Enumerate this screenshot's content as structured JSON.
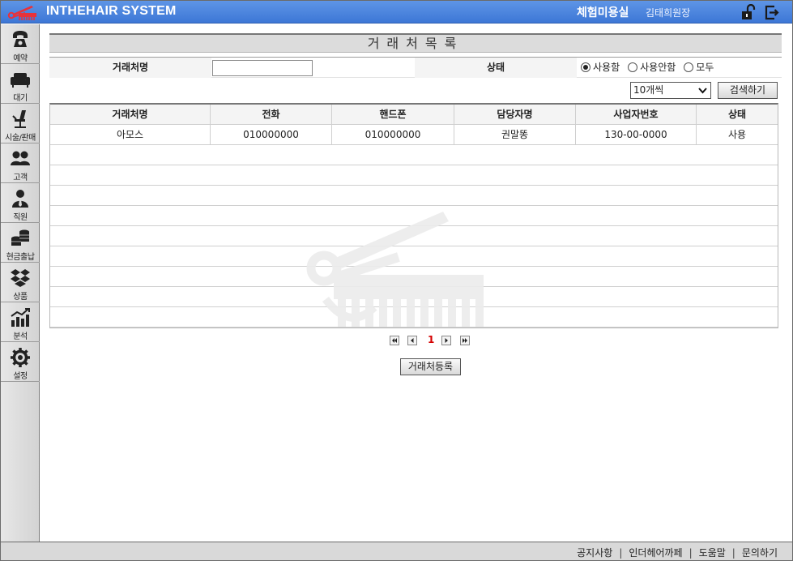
{
  "header": {
    "app_title": "INTHEHAIR SYSTEM",
    "shop_name": "체험미용실",
    "user_name": "김태희원장",
    "logo_icon": "scissors-comb-logo",
    "lock_icon": "unlock-icon",
    "logout_icon": "logout-icon",
    "colors": {
      "bar": "#4a85e0",
      "logo": "#e8323a"
    }
  },
  "sidebar": {
    "items": [
      {
        "label": "예약",
        "icon": "phone-icon"
      },
      {
        "label": "대기",
        "icon": "sofa-icon"
      },
      {
        "label": "시술/판매",
        "icon": "salon-chair-icon"
      },
      {
        "label": "고객",
        "icon": "customers-icon"
      },
      {
        "label": "직원",
        "icon": "staff-icon"
      },
      {
        "label": "현금출납",
        "icon": "coins-icon"
      },
      {
        "label": "상품",
        "icon": "product-box-icon"
      },
      {
        "label": "분석",
        "icon": "chart-icon"
      },
      {
        "label": "설정",
        "icon": "gear-icon"
      }
    ]
  },
  "main": {
    "title": "거래처목록",
    "search": {
      "partner_label": "거래처명",
      "partner_value": "",
      "status_label": "상태",
      "status_options": [
        {
          "label": "사용함",
          "checked": true
        },
        {
          "label": "사용안함",
          "checked": false
        },
        {
          "label": "모두",
          "checked": false
        }
      ],
      "page_size": "10개씩",
      "search_button": "검색하기"
    },
    "table": {
      "columns": [
        "거래처명",
        "전화",
        "핸드폰",
        "담당자명",
        "사업자번호",
        "상태"
      ],
      "rows": [
        [
          "아모스",
          "010000000",
          "010000000",
          "권말똥",
          "130-00-0000",
          "사용"
        ]
      ]
    },
    "pagination": {
      "current_page": "1"
    },
    "register_button": "거래처등록"
  },
  "footer": {
    "links": [
      "공지사항",
      "인더헤어까페",
      "도움말",
      "문의하기"
    ],
    "separator": "|"
  }
}
